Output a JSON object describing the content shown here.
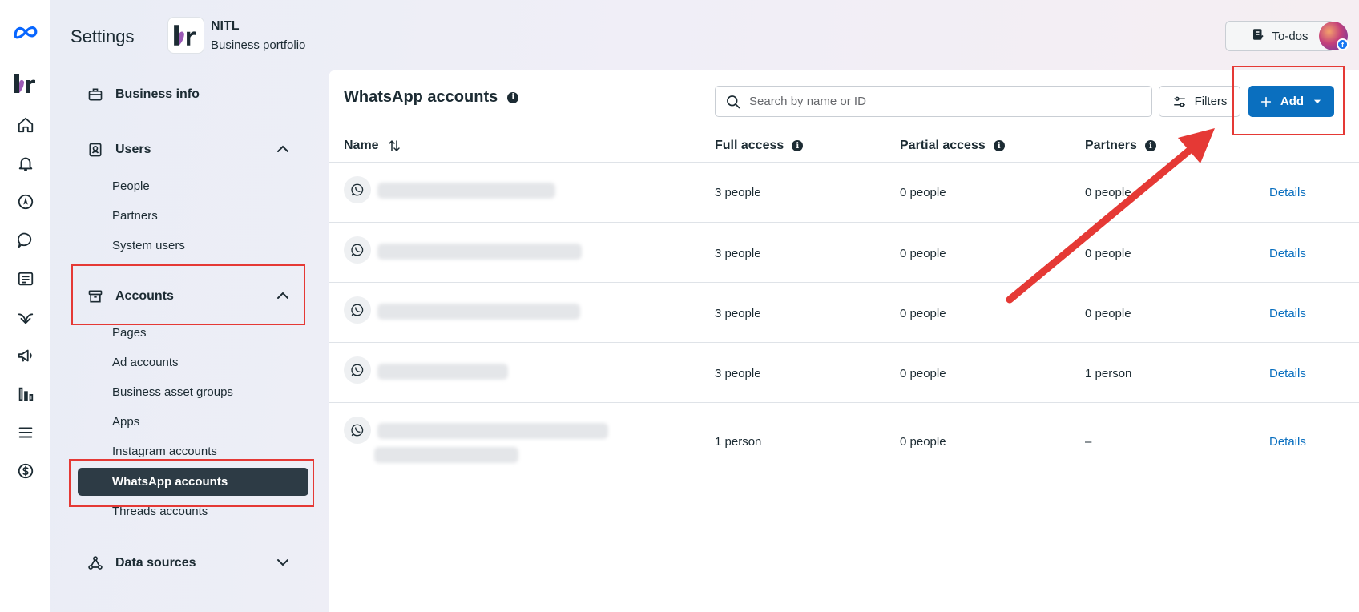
{
  "header": {
    "settings_title": "Settings",
    "portfolio_name": "NITL",
    "portfolio_subtitle": "Business portfolio",
    "todos_label": "To-dos",
    "avatar_badge": "f"
  },
  "rail": {
    "icons": [
      "meta-logo-icon",
      "portfolio-logo-icon",
      "home-icon",
      "bell-icon",
      "compass-icon",
      "chat-icon",
      "pages-icon",
      "catalog-icon",
      "megaphone-icon",
      "insights-icon",
      "menu-icon",
      "billing-icon"
    ]
  },
  "sidebar": {
    "business_info": "Business info",
    "users": {
      "label": "Users",
      "items": [
        "People",
        "Partners",
        "System users"
      ]
    },
    "accounts": {
      "label": "Accounts",
      "items": [
        "Pages",
        "Ad accounts",
        "Business asset groups",
        "Apps",
        "Instagram accounts",
        "WhatsApp accounts",
        "Threads accounts"
      ],
      "selected": "WhatsApp accounts"
    },
    "data_sources": {
      "label": "Data sources"
    }
  },
  "main": {
    "title": "WhatsApp accounts",
    "search_placeholder": "Search by name or ID",
    "filters_label": "Filters",
    "add_label": "Add",
    "columns": [
      "Name",
      "Full access",
      "Partial access",
      "Partners"
    ],
    "rows": [
      {
        "full": "3 people",
        "partial": "0 people",
        "partners": "0 people",
        "action": "Details"
      },
      {
        "full": "3 people",
        "partial": "0 people",
        "partners": "0 people",
        "action": "Details"
      },
      {
        "full": "3 people",
        "partial": "0 people",
        "partners": "0 people",
        "action": "Details"
      },
      {
        "full": "3 people",
        "partial": "0 people",
        "partners": "1 person",
        "action": "Details"
      },
      {
        "full": "1 person",
        "partial": "0 people",
        "partners": "–",
        "action": "Details"
      }
    ]
  },
  "colors": {
    "primary_blue": "#0a6fbf",
    "selected_nav": "#2d3b45",
    "annotation_red": "#e53935"
  }
}
